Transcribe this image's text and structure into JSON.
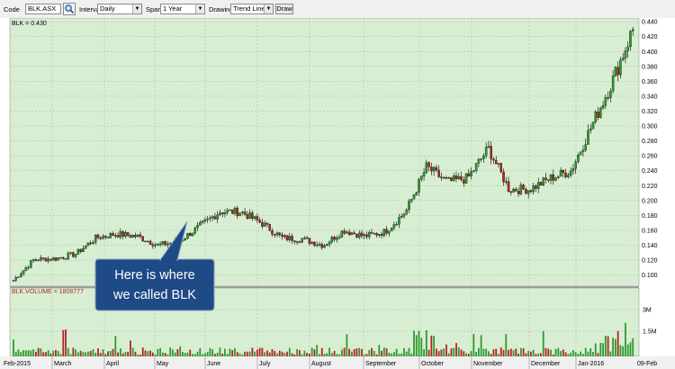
{
  "toolbar": {
    "code_label": "Code",
    "code_value": "BLK.ASX",
    "interval_label": "Interval",
    "interval_value": "Daily",
    "span_label": "Span",
    "span_value": "1 Year",
    "drawing_label": "Drawing",
    "drawing_value": "Trend Line",
    "draw_button": "Draw"
  },
  "colors": {
    "panel_bg": "#d8eed3",
    "grid": "#aab7aa",
    "up": "#2f9a2f",
    "down": "#b52424",
    "wick": "#000000",
    "callout_fill": "#1e4a86",
    "callout_border": "#8aa2c6"
  },
  "price_panel": {
    "label": "BLK = 0.430",
    "y_ticks": [
      "0.440",
      "0.420",
      "0.400",
      "0.380",
      "0.360",
      "0.340",
      "0.320",
      "0.300",
      "0.280",
      "0.260",
      "0.240",
      "0.220",
      "0.200",
      "0.180",
      "0.160",
      "0.140",
      "0.120",
      "0.100"
    ]
  },
  "volume_panel": {
    "label": "BLK.VOLUME = 1808777",
    "y_ticks": [
      "3M",
      "1.5M"
    ]
  },
  "x_labels": [
    "Feb-2015",
    "March",
    "April",
    "May",
    "June",
    "July",
    "August",
    "September",
    "October",
    "November",
    "December",
    "Jan-2016",
    "09-Feb"
  ],
  "callout": {
    "line1": "Here is where",
    "line2": "we called BLK"
  },
  "chart_data": {
    "type": "candlestick",
    "ylim": [
      0.085,
      0.445
    ],
    "price_path": [
      {
        "d": "Feb-2015",
        "close": 0.093
      },
      {
        "d": "Feb-2015",
        "close": 0.121
      },
      {
        "d": "March",
        "close": 0.122
      },
      {
        "d": "March",
        "close": 0.128
      },
      {
        "d": "March",
        "close": 0.15
      },
      {
        "d": "April",
        "close": 0.155
      },
      {
        "d": "April",
        "close": 0.152
      },
      {
        "d": "April",
        "close": 0.14
      },
      {
        "d": "May",
        "close": 0.145
      },
      {
        "d": "May",
        "close": 0.165
      },
      {
        "d": "May",
        "close": 0.185
      },
      {
        "d": "June",
        "close": 0.185
      },
      {
        "d": "June",
        "close": 0.17
      },
      {
        "d": "July",
        "close": 0.15
      },
      {
        "d": "July",
        "close": 0.148
      },
      {
        "d": "August",
        "close": 0.14
      },
      {
        "d": "August",
        "close": 0.16
      },
      {
        "d": "September",
        "close": 0.152
      },
      {
        "d": "September",
        "close": 0.158
      },
      {
        "d": "October",
        "close": 0.185
      },
      {
        "d": "October",
        "close": 0.245
      },
      {
        "d": "October",
        "close": 0.225
      },
      {
        "d": "November",
        "close": 0.23
      },
      {
        "d": "November",
        "close": 0.27
      },
      {
        "d": "December",
        "close": 0.215
      },
      {
        "d": "December",
        "close": 0.215
      },
      {
        "d": "Jan-2016",
        "close": 0.23
      },
      {
        "d": "Jan-2016",
        "close": 0.24
      },
      {
        "d": "Jan-2016",
        "close": 0.3
      },
      {
        "d": "Jan-2016",
        "close": 0.36
      },
      {
        "d": "09-Feb",
        "close": 0.43
      }
    ]
  }
}
